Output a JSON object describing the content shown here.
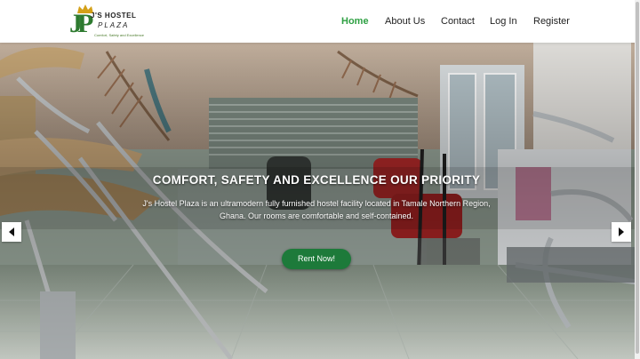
{
  "brand": {
    "monogram": "JP",
    "name_line1": "J'S HOSTEL",
    "name_line2": "PLAZA",
    "tagline": "Comfort, Safety and Excellence"
  },
  "nav": {
    "home": "Home",
    "about": "About Us",
    "contact": "Contact",
    "login": "Log In",
    "register": "Register"
  },
  "hero": {
    "title": "COMFORT, SAFETY AND EXCELLENCE OUR PRIORITY",
    "description": "J's Hostel Plaza is an ultramodern fully furnished hostel facility located in Tamale Northern Region, Ghana. Our rooms are comfortable and self-contained.",
    "cta_label": "Rent Now!"
  },
  "colors": {
    "accent": "#2ea043",
    "cta": "#1d7a3a"
  },
  "icons": {
    "prev": "chevron-left-icon",
    "next": "chevron-right-icon"
  }
}
